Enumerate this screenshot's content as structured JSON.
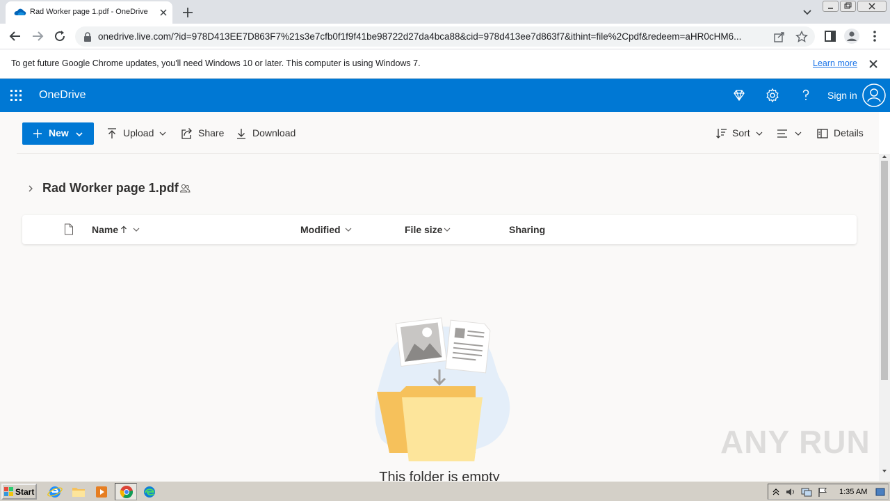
{
  "browser": {
    "tab_title": "Rad Worker page 1.pdf - OneDrive",
    "url": "onedrive.live.com/?id=978D413EE7D863F7%21s3e7cfb0f1f9f41be98722d27da4bca88&cid=978d413ee7d863f7&ithint=file%2Cpdf&redeem=aHR0cHM6...",
    "infobar_message": "To get future Google Chrome updates, you'll need Windows 10 or later. This computer is using Windows 7.",
    "infobar_link": "Learn more"
  },
  "onedrive": {
    "brand": "OneDrive",
    "sign_in": "Sign in",
    "accent_color": "#0078d4"
  },
  "commandbar": {
    "new_label": "New",
    "upload_label": "Upload",
    "share_label": "Share",
    "download_label": "Download",
    "sort_label": "Sort",
    "details_label": "Details"
  },
  "folder": {
    "name": "Rad Worker page 1.pdf"
  },
  "list": {
    "columns": [
      {
        "label": "Name",
        "sorted": "ascending"
      },
      {
        "label": "Modified"
      },
      {
        "label": "File size"
      },
      {
        "label": "Sharing"
      }
    ],
    "empty_message": "This folder is empty"
  },
  "watermark": "ANY RUN",
  "taskbar": {
    "start_label": "Start",
    "clock": "1:35 AM"
  }
}
